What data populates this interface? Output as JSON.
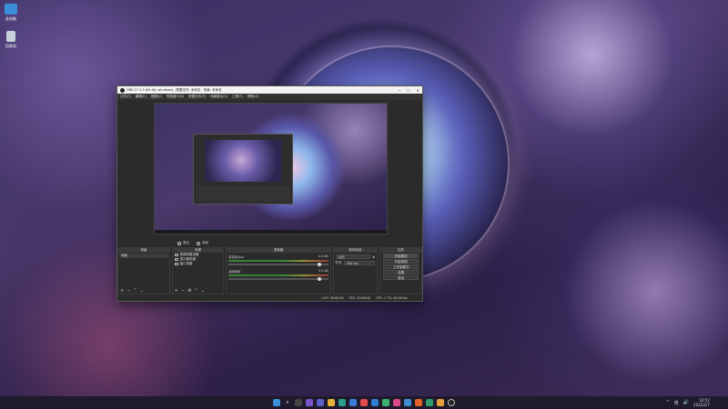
{
  "desktop": {
    "icons": [
      {
        "label": "此电脑",
        "icon": "computer-icon"
      },
      {
        "label": "回收站",
        "icon": "recycle-bin-icon"
      }
    ]
  },
  "obs": {
    "title": "OBS 27.1.3 (64-bit, windows) - 配置文件: 未命名 - 场景: 未命名",
    "window_controls": [
      "—",
      "☐",
      "✕"
    ],
    "menu": [
      "文件(F)",
      "编辑(E)",
      "视图(V)",
      "停靠窗口(D)",
      "配置文件(P)",
      "场景集合(S)",
      "工具(T)",
      "帮助(H)"
    ],
    "preview_controls": [
      "混合",
      "添加"
    ],
    "docks": {
      "scenes": {
        "title": "场景",
        "items": [
          "场景"
        ]
      },
      "sources": {
        "title": "来源",
        "items": [
          "视频采集设备",
          "显示器采集",
          "窗口采集"
        ]
      },
      "mixer": {
        "title": "混音器",
        "tracks": [
          {
            "name": "麦克风/Aux",
            "level": "0.0 dB"
          },
          {
            "name": "桌面音频",
            "level": "0.0 dB"
          }
        ]
      },
      "transitions": {
        "title": "转场特效",
        "type": "淡出",
        "duration_label": "时长",
        "duration": "300 ms"
      },
      "controls": {
        "title": "控件",
        "buttons": [
          "开始推流",
          "开始录制",
          "工作室模式",
          "设置",
          "退出"
        ]
      }
    },
    "status": {
      "live": "LIVE: 00:00:00",
      "rec": "REC: 00:00:00",
      "cpu": "CPU: 1.7%, 60.00 fps"
    }
  },
  "taskbar": {
    "clock_time": "10:52",
    "clock_date": "2022/2/7",
    "tray": [
      "^",
      "英",
      "🔊"
    ]
  },
  "colors": {
    "taskbar_bg": "#1f1a2c",
    "obs_dark": "#2b2b2b"
  }
}
